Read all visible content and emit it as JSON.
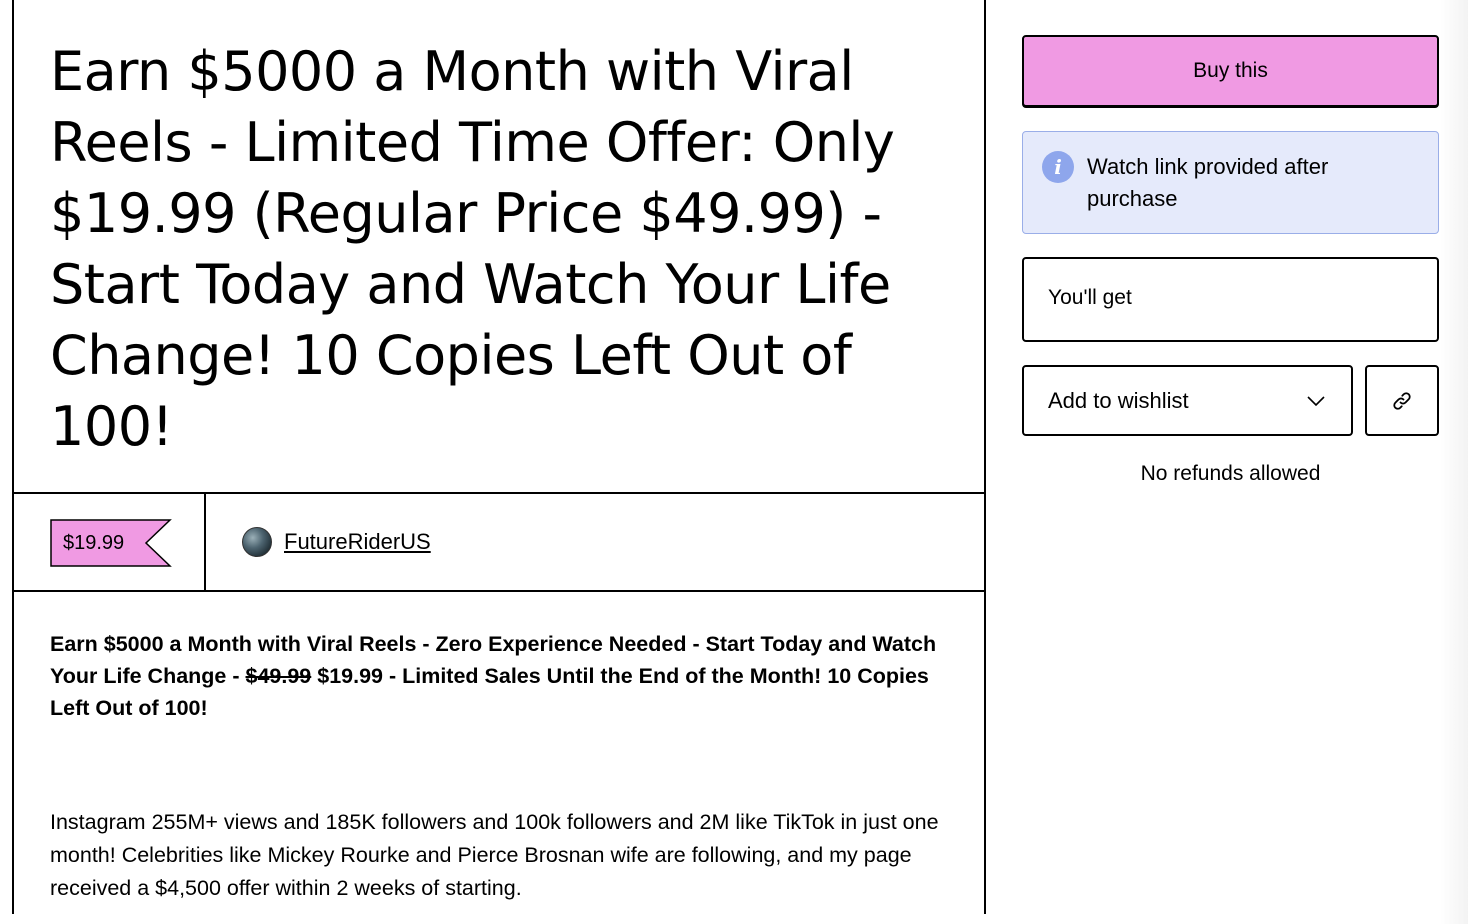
{
  "product": {
    "title": "Earn $5000 a Month with Viral Reels - Limited Time Offer: Only $19.99 (Regular Price $49.99) - Start Today and Watch Your Life Change! 10 Copies Left Out of 100!",
    "price": "$19.99",
    "seller_name": "FutureRiderUS"
  },
  "description": {
    "headline_part1": "Earn $5000 a Month with Viral Reels - Zero Experience Needed - Start Today and Watch Your Life Change - ",
    "old_price": "$49.99",
    "headline_part2": " $19.99 - Limited Sales Until the End of the Month! 10 Copies Left Out of 100!",
    "body": "Instagram 255M+ views and 185K followers and 100k followers and 2M like TikTok in just one month! Celebrities like Mickey Rourke and Pierce Brosnan wife are following, and my page received a $4,500 offer within 2 weeks of starting."
  },
  "sidebar": {
    "buy_label": "Buy this",
    "info_text": "Watch link provided after purchase",
    "youll_get_label": "You'll get",
    "wishlist_label": "Add to wishlist",
    "refund_note": "No refunds allowed"
  },
  "icons": {
    "info": "info-icon",
    "chevron": "chevron-down-icon",
    "link": "link-icon"
  },
  "colors": {
    "accent_pink": "#f09ae3",
    "info_bg": "#e5eafb",
    "info_icon": "#8ea6ec"
  }
}
